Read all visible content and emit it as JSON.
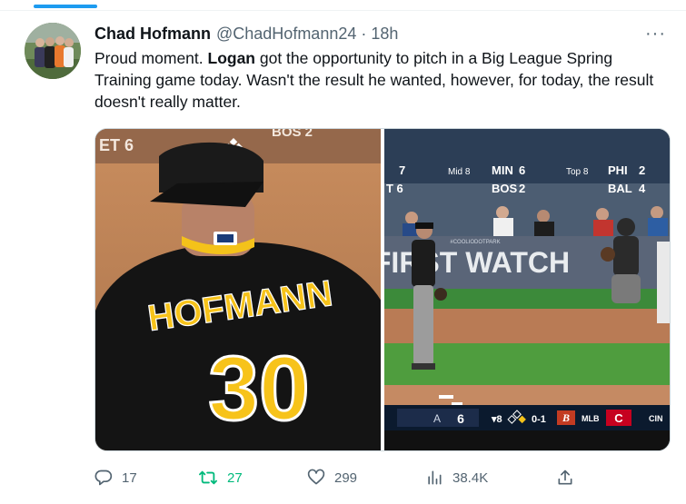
{
  "tweet": {
    "author_name": "Chad Hofmann",
    "author_handle": "@ChadHofmann24",
    "separator": "·",
    "timestamp": "18h",
    "more_label": "···",
    "text_part1": "Proud moment. ",
    "text_bold": "Logan",
    "text_part2": " got the opportunity to pitch in a Big League Spring Training game today. Wasn't the result he wanted, however, for today, the result doesn't really matter."
  },
  "media": {
    "image1": {
      "jersey_name": "HOFMANN",
      "jersey_number": "30",
      "score_top_left": "ET 6",
      "score_top_right": "BOS 2"
    },
    "image2": {
      "score_rows": [
        {
          "left_num": "7",
          "inning": "Mid 8",
          "team_a": "MIN",
          "score_a": "6",
          "inning2": "Top 8",
          "team_b": "PHI",
          "score_b": "2"
        },
        {
          "left_num": "T 6",
          "inning": "",
          "team_a": "BOS",
          "score_a": "2",
          "inning2": "",
          "team_b": "BAL",
          "score_b": "4"
        }
      ],
      "wall_text": "FIRST WATCH",
      "wall_small": "#COOLIODOTPARK",
      "bug_score": "6",
      "bug_inning": "▾8",
      "bug_count": "0-1",
      "bug_mlb": "MLB",
      "bug_team": "CIN"
    }
  },
  "actions": {
    "replies": "17",
    "retweets": "27",
    "likes": "299",
    "views": "38.4K"
  },
  "colors": {
    "accent": "#1d9bf0",
    "retweet": "#00ba7c",
    "muted": "#536471"
  }
}
